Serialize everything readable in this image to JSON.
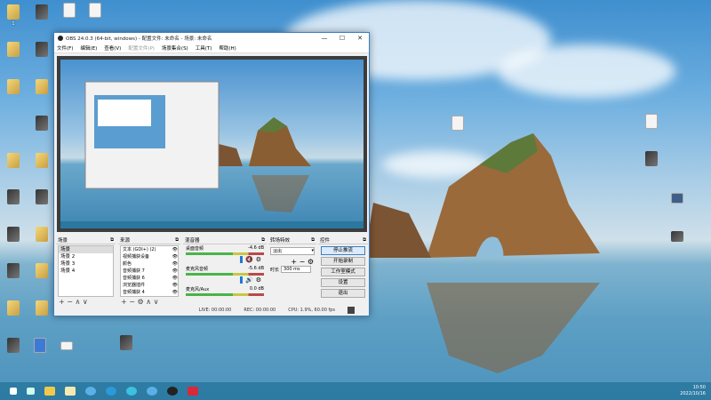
{
  "desktop": {
    "icon_label_first": "1"
  },
  "window": {
    "title": "OBS 24.0.3 (64-bit, windows) - 配置文件: 未命名 - 场景: 未命名",
    "minimize": "—",
    "maximize": "☐",
    "close": "✕",
    "menu": [
      "文件(F)",
      "编辑(E)",
      "查看(V)",
      "配置文件(P)",
      "场景集合(S)",
      "工具(T)",
      "帮助(H)"
    ]
  },
  "docks": {
    "scenes": {
      "title": "场景",
      "items": [
        "场景",
        "场景 2",
        "场景 3",
        "场景 4"
      ],
      "toolbar": "+ − ∧ ∨"
    },
    "sources": {
      "title": "来源",
      "items": [
        "文本 (GDI+) (2)",
        "视频捕获设备",
        "颜色",
        "音频捕获 7",
        "音频捕获 6",
        "浏览器插件",
        "音频捕获 4"
      ],
      "toolbar": "+ − ⚙ ∧ ∨"
    },
    "mixer": {
      "title": "混音器",
      "channels": [
        {
          "name": "桌面音频",
          "db": "-4.6 dB",
          "muted": true
        },
        {
          "name": "麦克风音频",
          "db": "-5.6 dB",
          "muted": false
        },
        {
          "name": "麦克风/Aux",
          "db": "0.0 dB",
          "muted": false
        }
      ]
    },
    "transitions": {
      "title": "转场特效",
      "selected": "淡出",
      "duration_label": "时长",
      "duration": "300 ms"
    },
    "controls": {
      "title": "控件",
      "buttons": [
        "停止推流",
        "开始录制",
        "工作室模式",
        "设置",
        "退出"
      ]
    }
  },
  "status": {
    "live": "LIVE: 00:00:00",
    "rec": "REC: 00:00:00",
    "cpu": "CPU: 1.9%, 60.00 fps"
  },
  "taskbar": {
    "time": "10:50",
    "date": "2022/10/16"
  }
}
